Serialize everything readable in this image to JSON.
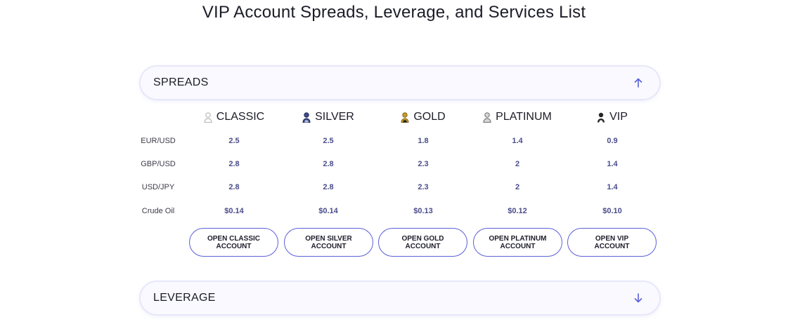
{
  "page": {
    "title": "VIP Account Spreads, Leverage, and Services List"
  },
  "sections": {
    "spreads": {
      "label": "SPREADS",
      "expanded": true
    },
    "leverage": {
      "label": "LEVERAGE",
      "expanded": false
    }
  },
  "colors": {
    "accent": "#5b5fd8",
    "value_text": "#4a4c8c",
    "header_bg": "#f9f9ff"
  },
  "spreads_table": {
    "columns": [
      {
        "name": "CLASSIC",
        "icon": "user-icon",
        "icon_color": "#b9b9b9"
      },
      {
        "name": "SILVER",
        "icon": "user-icon",
        "icon_color": "#3b4a8a"
      },
      {
        "name": "GOLD",
        "icon": "user-icon",
        "icon_color": "#c99a2e"
      },
      {
        "name": "PLATINUM",
        "icon": "user-icon",
        "icon_color": "#8f8f8f"
      },
      {
        "name": "VIP",
        "icon": "user-icon",
        "icon_color": "#262626"
      }
    ],
    "rows": [
      {
        "label": "EUR/USD",
        "values": [
          "2.5",
          "2.5",
          "1.8",
          "1.4",
          "0.9"
        ]
      },
      {
        "label": "GBP/USD",
        "values": [
          "2.8",
          "2.8",
          "2.3",
          "2",
          "1.4"
        ]
      },
      {
        "label": "USD/JPY",
        "values": [
          "2.8",
          "2.8",
          "2.3",
          "2",
          "1.4"
        ]
      },
      {
        "label": "Crude Oil",
        "values": [
          "$0.14",
          "$0.14",
          "$0.13",
          "$0.12",
          "$0.10"
        ]
      }
    ],
    "buttons": [
      "OPEN CLASSIC ACCOUNT",
      "OPEN SILVER ACCOUNT",
      "OPEN GOLD ACCOUNT",
      "OPEN PLATINUM ACCOUNT",
      "OPEN VIP ACCOUNT"
    ]
  }
}
